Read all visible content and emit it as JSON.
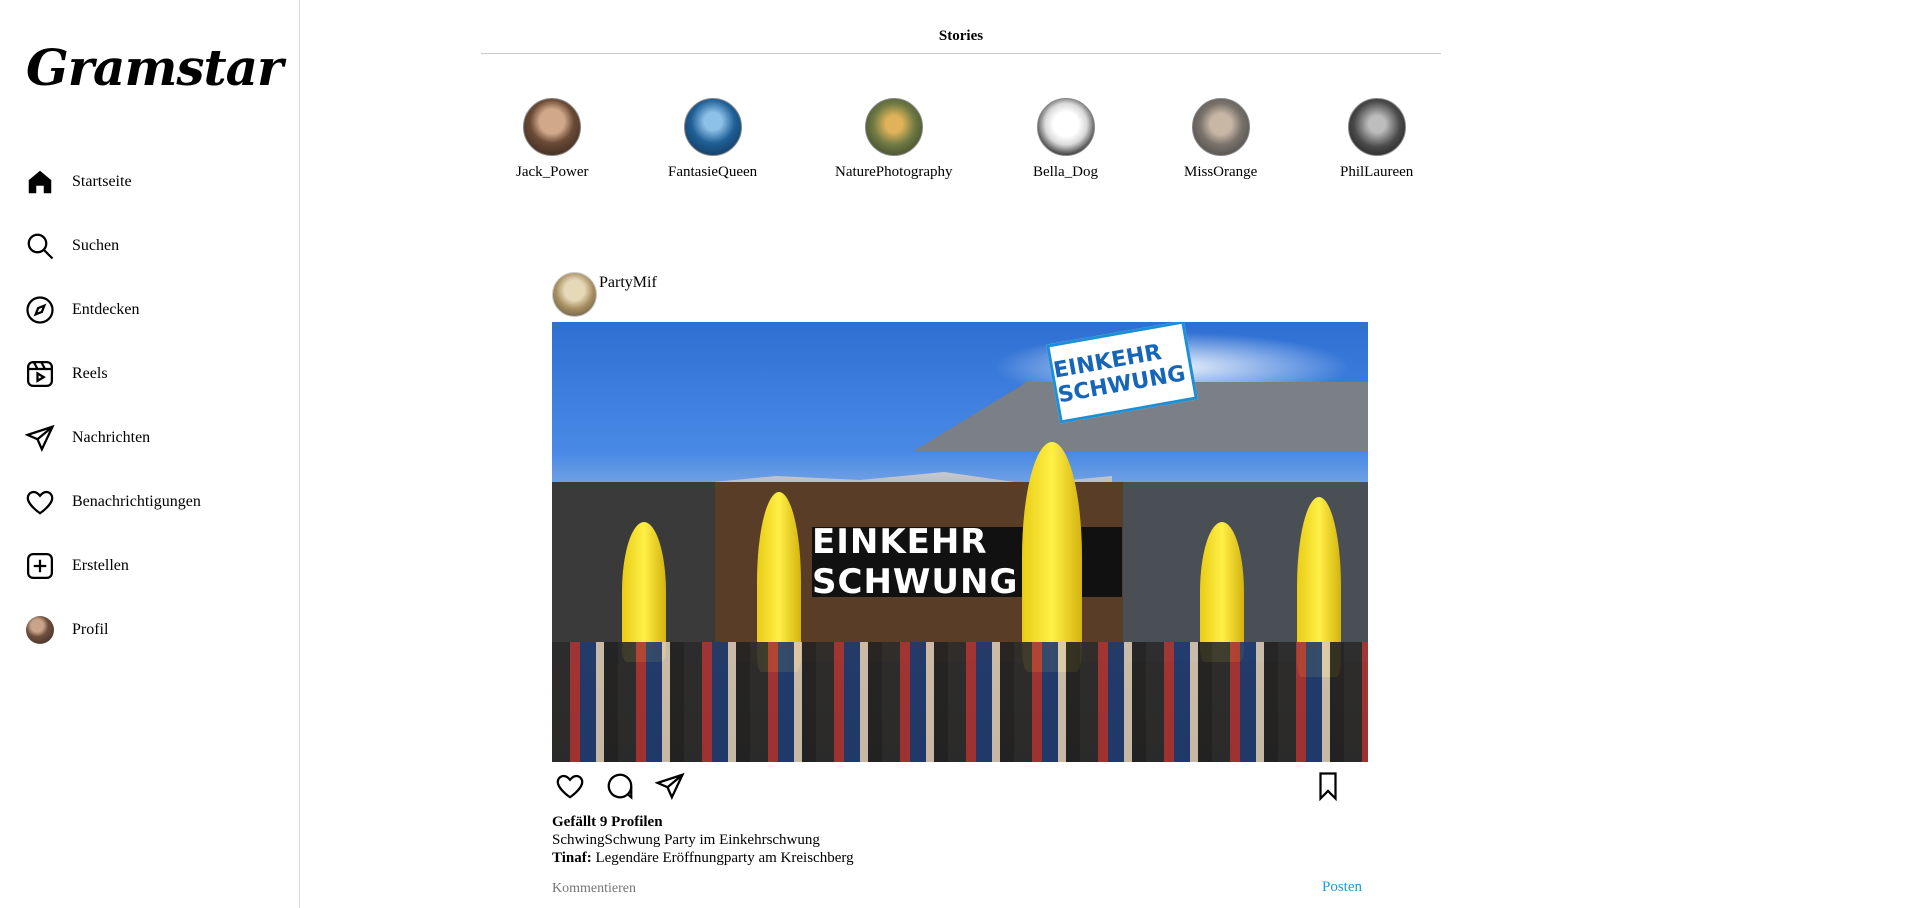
{
  "app": {
    "logo": "Gramstar"
  },
  "sidebar": {
    "items": [
      {
        "label": "Startseite",
        "icon": "home-icon"
      },
      {
        "label": "Suchen",
        "icon": "search-icon"
      },
      {
        "label": "Entdecken",
        "icon": "compass-icon"
      },
      {
        "label": "Reels",
        "icon": "reels-icon"
      },
      {
        "label": "Nachrichten",
        "icon": "send-icon"
      },
      {
        "label": "Benachrichtigungen",
        "icon": "heart-icon"
      },
      {
        "label": "Erstellen",
        "icon": "plus-square-icon"
      },
      {
        "label": "Profil",
        "icon": "avatar"
      }
    ]
  },
  "stories": {
    "title": "Stories",
    "items": [
      {
        "name": "Jack_Power",
        "color": "#7a5a45"
      },
      {
        "name": "FantasieQueen",
        "color": "#1a4a7a"
      },
      {
        "name": "NaturePhotography",
        "color": "#6a7a3a"
      },
      {
        "name": "Bella_Dog",
        "color": "#2a2a2a"
      },
      {
        "name": "MissOrange",
        "color": "#6a6a6a"
      },
      {
        "name": "PhilLaureen",
        "color": "#3a3a3a"
      }
    ]
  },
  "post": {
    "username": "PartyMif",
    "image": {
      "sign_text": "EINKEHR SCHWUNG",
      "banner_text": "EINKEHR SCHWUNG"
    },
    "likes": "Gefällt 9 Profilen",
    "caption": "SchwingSchwung Party im Einkehrschwung",
    "comment": {
      "author": "Tinaf:",
      "text": " Legendäre Eröffnungparty am Kreischberg"
    },
    "comment_placeholder": "Kommentieren",
    "post_button": "Posten"
  }
}
